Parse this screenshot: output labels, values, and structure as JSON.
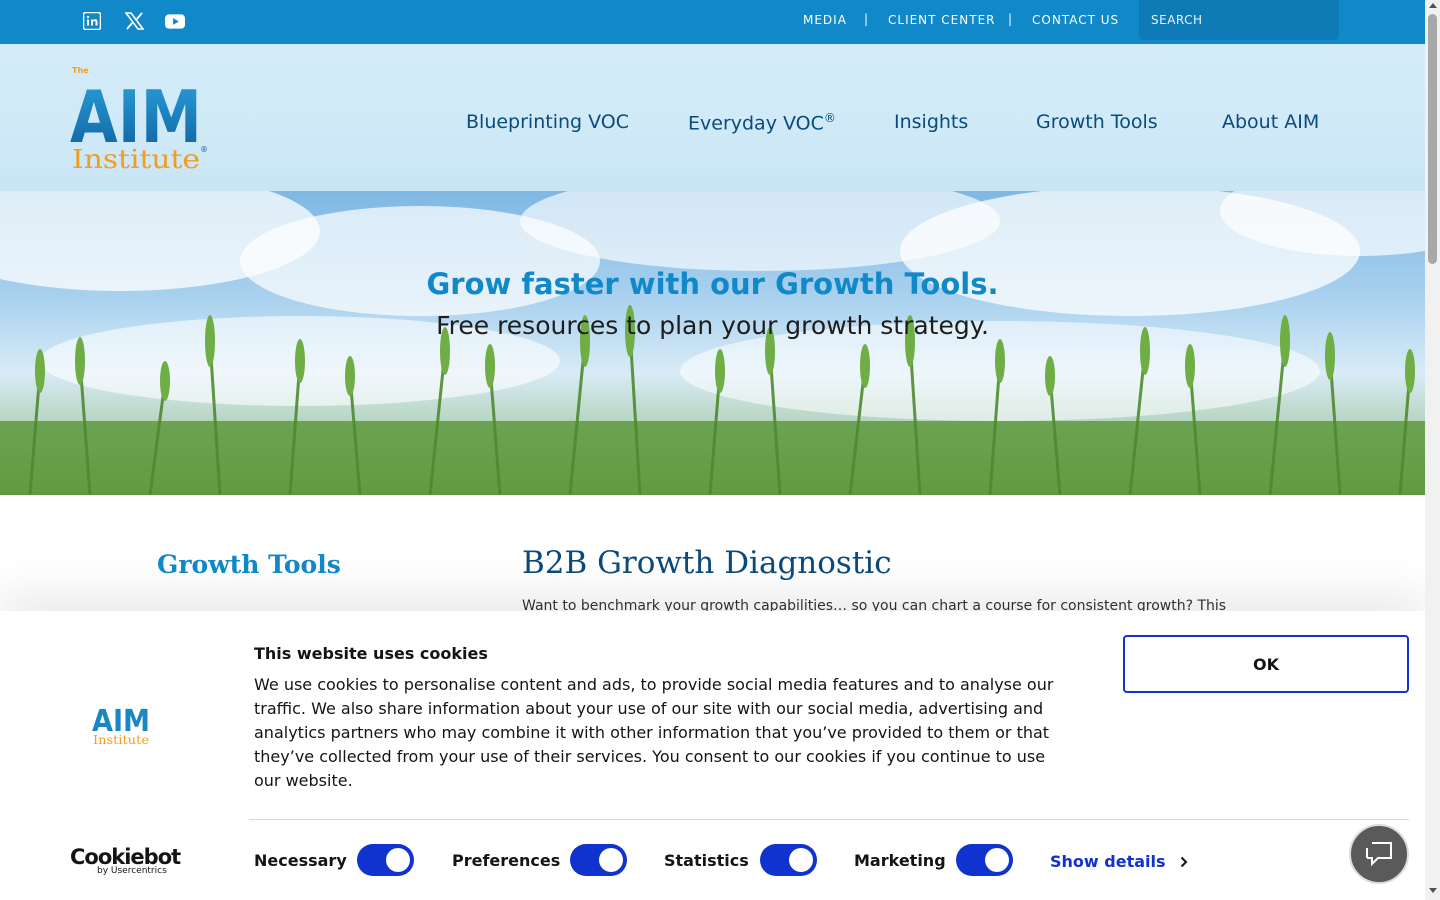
{
  "topbar": {
    "social": [
      {
        "name": "linkedin-icon"
      },
      {
        "name": "x-twitter-icon"
      },
      {
        "name": "youtube-icon"
      }
    ],
    "links": [
      "MEDIA",
      "CLIENT CENTER",
      "CONTACT US"
    ],
    "separator": "|",
    "search_placeholder": "SEARCH"
  },
  "header": {
    "logo": {
      "the": "The",
      "aim": "AIM",
      "institute": "Institute",
      "reg": "®"
    },
    "nav": [
      "Blueprinting VOC",
      "Everyday VOC",
      "Insights",
      "Growth Tools",
      "About AIM"
    ],
    "nav_sup": "®"
  },
  "hero": {
    "title": "Grow faster with our Growth Tools.",
    "subtitle": "Free resources to plan your growth strategy."
  },
  "sidebar": {
    "title": "Growth Tools"
  },
  "content": {
    "title": "B2B Growth Diagnostic",
    "body": "Want to benchmark your growth capabilities… so you can chart a course for consistent growth? This"
  },
  "cookie": {
    "title": "This website uses cookies",
    "text": "We use cookies to personalise content and ads, to provide social media features and to analyse our traffic. We also share information about your use of our site with our social media, advertising and analytics partners who may combine it with other information that you’ve provided to them or that they’ve collected from your use of their services. You consent to our cookies if you continue to use our website.",
    "ok_label": "OK",
    "brand": "Cookiebot",
    "brand_by": "by Usercentrics",
    "options": [
      {
        "label": "Necessary",
        "on": true
      },
      {
        "label": "Preferences",
        "on": true
      },
      {
        "label": "Statistics",
        "on": true
      },
      {
        "label": "Marketing",
        "on": true
      }
    ],
    "show_details": "Show details"
  },
  "colors": {
    "topbar": "#1189c9",
    "nav_text": "#0b4a7c",
    "accent": "#1189c9",
    "logo_orange": "#f39c1f",
    "cookie_blue": "#1032cf"
  }
}
